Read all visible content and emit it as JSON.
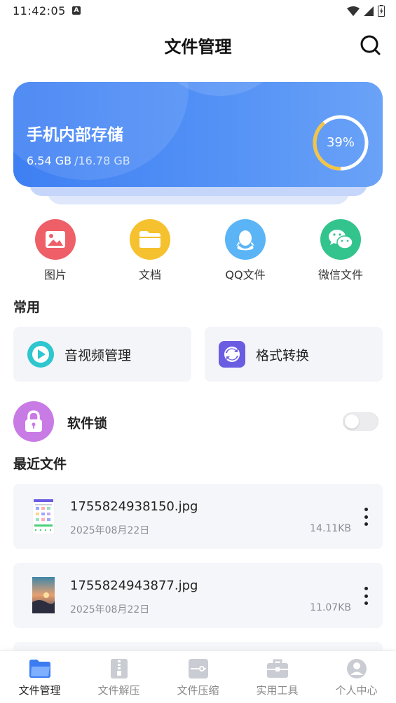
{
  "status_bar": {
    "time": "11:42:05",
    "a_badge": "A"
  },
  "header": {
    "title": "文件管理"
  },
  "storage": {
    "title": "手机内部存储",
    "used": "6.54 GB",
    "total": "/16.78 GB",
    "percent_label": "39%",
    "percent_value": 39
  },
  "categories": [
    {
      "label": "图片",
      "icon": "image-icon",
      "color": "#ee5f68"
    },
    {
      "label": "文档",
      "icon": "folder-icon",
      "color": "#f5c12e"
    },
    {
      "label": "QQ文件",
      "icon": "qq-penguin-icon",
      "color": "#5ab4f5"
    },
    {
      "label": "微信文件",
      "icon": "wechat-icon",
      "color": "#33c48d"
    }
  ],
  "common": {
    "title": "常用",
    "av_manage": "音视频管理",
    "format_convert": "格式转换"
  },
  "app_lock": {
    "label": "软件锁",
    "enabled": false
  },
  "recent": {
    "title": "最近文件",
    "files": [
      {
        "name": "1755824938150.jpg",
        "date": "2025年08月22日",
        "size": "14.11KB"
      },
      {
        "name": "1755824943877.jpg",
        "date": "2025年08月22日",
        "size": "11.07KB"
      }
    ]
  },
  "nav": [
    {
      "label": "文件管理",
      "icon": "folder-icon",
      "active": true
    },
    {
      "label": "文件解压",
      "icon": "zip-icon",
      "active": false
    },
    {
      "label": "文件压缩",
      "icon": "compress-icon",
      "active": false
    },
    {
      "label": "实用工具",
      "icon": "toolbox-icon",
      "active": false
    },
    {
      "label": "个人中心",
      "icon": "user-icon",
      "active": false
    }
  ],
  "colors": {
    "accent": "#3e7ff3",
    "ring_used": "#f3c445"
  }
}
